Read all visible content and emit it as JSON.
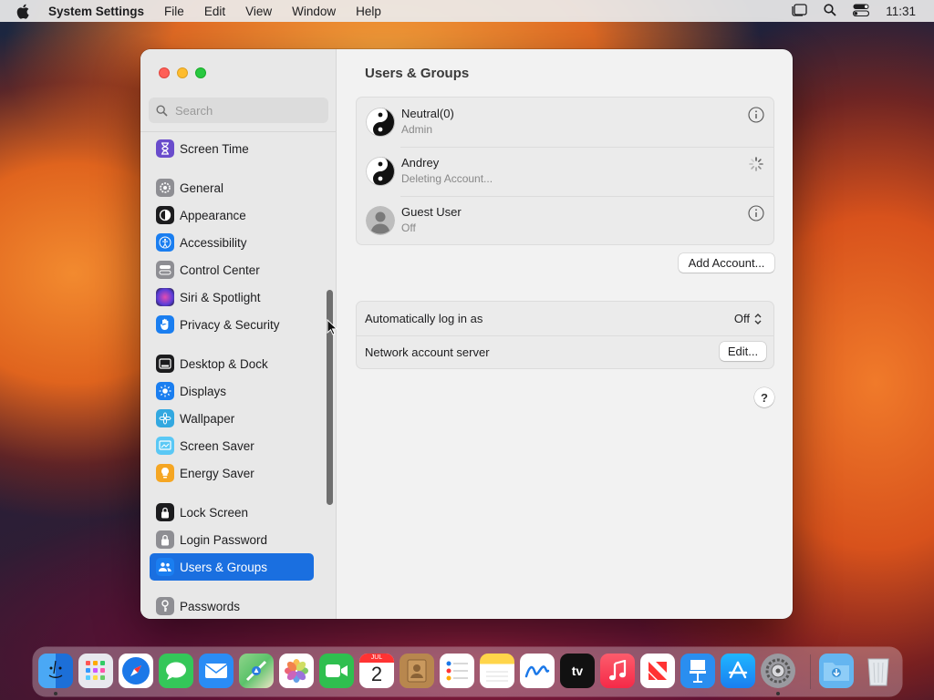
{
  "menubar": {
    "app_name": "System Settings",
    "menus": [
      "File",
      "Edit",
      "View",
      "Window",
      "Help"
    ],
    "clock": "11:31"
  },
  "sidebar": {
    "search_placeholder": "Search",
    "items": [
      {
        "label": "Screen Time",
        "icon": "hourglass-icon",
        "color": "#6a4ccc"
      },
      {
        "label": "General",
        "icon": "gear-icon",
        "color": "#8e8e93"
      },
      {
        "label": "Appearance",
        "icon": "appearance-icon",
        "color": "#1c1c1e"
      },
      {
        "label": "Accessibility",
        "icon": "accessibility-icon",
        "color": "#1a7ef0"
      },
      {
        "label": "Control Center",
        "icon": "control-center-icon",
        "color": "#8e8e93"
      },
      {
        "label": "Siri & Spotlight",
        "icon": "siri-icon",
        "color": "#c03aa0"
      },
      {
        "label": "Privacy & Security",
        "icon": "hand-icon",
        "color": "#1a7ef0"
      },
      {
        "label": "Desktop & Dock",
        "icon": "dock-icon",
        "color": "#1c1c1e"
      },
      {
        "label": "Displays",
        "icon": "sun-icon",
        "color": "#1a7ef0"
      },
      {
        "label": "Wallpaper",
        "icon": "flower-icon",
        "color": "#32a8e0"
      },
      {
        "label": "Screen Saver",
        "icon": "screen-saver-icon",
        "color": "#5ac8f5"
      },
      {
        "label": "Energy Saver",
        "icon": "lightbulb-icon",
        "color": "#f5a623"
      },
      {
        "label": "Lock Screen",
        "icon": "lock-icon",
        "color": "#1c1c1e"
      },
      {
        "label": "Login Password",
        "icon": "lock-icon",
        "color": "#8e8e93"
      },
      {
        "label": "Users & Groups",
        "icon": "users-icon",
        "color": "#1a7ef0",
        "selected": true
      },
      {
        "label": "Passwords",
        "icon": "key-icon",
        "color": "#8e8e93"
      }
    ]
  },
  "content": {
    "title": "Users & Groups",
    "users": [
      {
        "name": "Neutral(0)",
        "role": "Admin",
        "avatar": "yin-yang",
        "action": "info-icon"
      },
      {
        "name": "Andrey",
        "role": "Deleting Account...",
        "avatar": "yin-yang",
        "action": "spinner-icon"
      },
      {
        "name": "Guest User",
        "role": "Off",
        "avatar": "guest",
        "action": "info-icon"
      }
    ],
    "add_account_label": "Add Account...",
    "auto_login_label": "Automatically log in as",
    "auto_login_value": "Off",
    "network_server_label": "Network account server",
    "edit_label": "Edit...",
    "help_label": "?"
  },
  "dock": {
    "apps": [
      {
        "name": "Finder",
        "color": "#1e8ef0"
      },
      {
        "name": "Launchpad",
        "color": "#d8d8e0"
      },
      {
        "name": "Safari",
        "color": "#1b78e8"
      },
      {
        "name": "Messages",
        "color": "#34c759"
      },
      {
        "name": "Mail",
        "color": "#2a8cf5"
      },
      {
        "name": "Maps",
        "color": "#5bc26a"
      },
      {
        "name": "Photos",
        "color": "#ffffff"
      },
      {
        "name": "FaceTime",
        "color": "#2fbf4f"
      },
      {
        "name": "Calendar",
        "color": "#ffffff"
      },
      {
        "name": "Contacts",
        "color": "#b8874e"
      },
      {
        "name": "Reminders",
        "color": "#ffffff"
      },
      {
        "name": "Notes",
        "color": "#ffd54a"
      },
      {
        "name": "Freeform",
        "color": "#ffffff"
      },
      {
        "name": "TV",
        "color": "#111111"
      },
      {
        "name": "Music",
        "color": "#fa3a4e"
      },
      {
        "name": "News",
        "color": "#ffffff"
      },
      {
        "name": "Keynote",
        "color": "#2a8ef0"
      },
      {
        "name": "App Store",
        "color": "#1a8cf5"
      },
      {
        "name": "System Settings",
        "color": "#8e8e93"
      },
      {
        "name": "Downloads",
        "color": "#64b5f0"
      },
      {
        "name": "Trash",
        "color": "#d0d4d8"
      }
    ],
    "calendar_month": "JUL",
    "calendar_day": "2",
    "tv_label": "tv"
  }
}
